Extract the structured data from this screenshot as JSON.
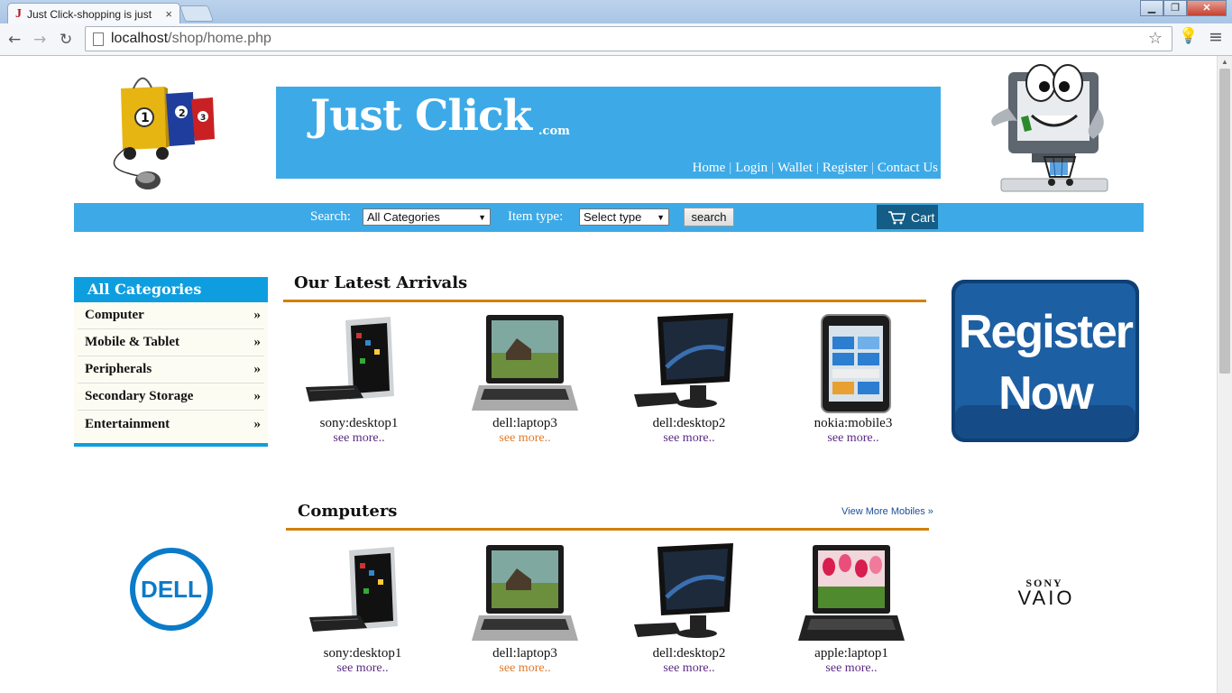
{
  "browser": {
    "tab_title": "Just Click-shopping is just",
    "tab_favicon": "J",
    "tab_close": "×",
    "url_host": "localhost",
    "url_path": "/shop/home.php",
    "window_min": "▁",
    "window_restore": "❐",
    "window_close": "✕"
  },
  "header": {
    "brand": "Just Click",
    "brand_suffix": ".com",
    "nav": [
      "Home",
      "Login",
      "Wallet",
      "Register",
      "Contact Us"
    ]
  },
  "searchbar": {
    "search_label": "Search:",
    "category_value": "All Categories",
    "type_label": "Item type:",
    "type_value": "Select type",
    "search_button": "search",
    "cart_label": "Cart"
  },
  "sidebar": {
    "title": "All Categories",
    "arrow": "»",
    "items": [
      "Computer",
      "Mobile & Tablet",
      "Peripherals",
      "Secondary Storage",
      "Entertainment"
    ]
  },
  "latest": {
    "title": "Our Latest Arrivals",
    "products": [
      {
        "name": "sony:desktop1",
        "link": "see more..",
        "icon": "all-in-one-pc"
      },
      {
        "name": "dell:laptop3",
        "link": "see more..",
        "icon": "laptop"
      },
      {
        "name": "dell:desktop2",
        "link": "see more..",
        "icon": "desktop"
      },
      {
        "name": "nokia:mobile3",
        "link": "see more..",
        "icon": "mobile-phone"
      }
    ]
  },
  "computers": {
    "title": "Computers",
    "view_more": "View More Mobiles »",
    "products": [
      {
        "name": "sony:desktop1",
        "link": "see more..",
        "icon": "all-in-one-pc"
      },
      {
        "name": "dell:laptop3",
        "link": "see more..",
        "icon": "laptop"
      },
      {
        "name": "dell:desktop2",
        "link": "see more..",
        "icon": "desktop"
      },
      {
        "name": "apple:laptop1",
        "link": "see more..",
        "icon": "laptop-tulips"
      }
    ]
  },
  "register_banner": {
    "line1": "Register",
    "line2": "Now"
  },
  "brands": {
    "left": "DELL",
    "right_top": "SONY",
    "right_bottom": "VAIO"
  },
  "colors": {
    "banner_blue": "#3daae7",
    "category_blue": "#0e9ee0",
    "section_rule": "#d27f0b",
    "cart_blue": "#135d86",
    "see_more_purple": "#5a2a82",
    "see_more_orange": "#e07a2b",
    "dell_blue": "#0a7bc9",
    "register_blue": "#1d5fa3"
  }
}
